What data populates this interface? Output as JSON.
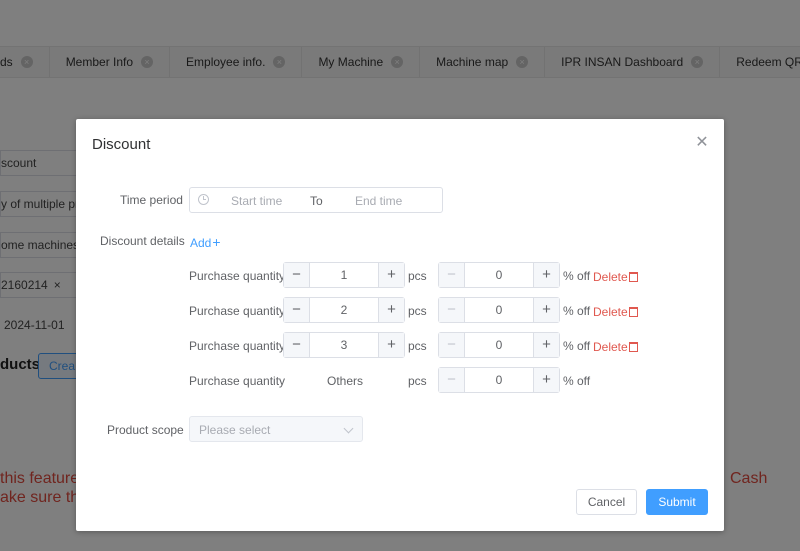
{
  "background": {
    "tabs": [
      {
        "label": "ds"
      },
      {
        "label": "Member Info"
      },
      {
        "label": "Employee info."
      },
      {
        "label": "My Machine"
      },
      {
        "label": "Machine map"
      },
      {
        "label": "IPR INSAN Dashboard"
      },
      {
        "label": "Redeem QR code"
      }
    ],
    "fields": {
      "discount": "scount",
      "multiple": "y of multiple pro",
      "machines": "ome machines",
      "tag": "2160214",
      "date": "2024-11-01"
    },
    "products_heading": "ducts",
    "create_button": "Crea",
    "warning_left_1": "this feature",
    "warning_left_2": "ake sure th",
    "warning_right": "Cash"
  },
  "dialog": {
    "title": "Discount",
    "time_period_label": "Time period",
    "start_placeholder": "Start time",
    "range_separator": "To",
    "end_placeholder": "End time",
    "discount_details_label": "Discount details",
    "add_label": "Add",
    "rows": [
      {
        "label": "Purchase quantity",
        "quantity": "1",
        "quantity_unit": "pcs",
        "discount": "0",
        "discount_unit": "% off",
        "delete_label": "Delete"
      },
      {
        "label": "Purchase quantity",
        "quantity": "2",
        "quantity_unit": "pcs",
        "discount": "0",
        "discount_unit": "% off",
        "delete_label": "Delete"
      },
      {
        "label": "Purchase quantity",
        "quantity": "3",
        "quantity_unit": "pcs",
        "discount": "0",
        "discount_unit": "% off",
        "delete_label": "Delete"
      }
    ],
    "others_row": {
      "label": "Purchase quantity",
      "quantity_text": "Others",
      "quantity_unit": "pcs",
      "discount": "0",
      "discount_unit": "% off"
    },
    "product_scope_label": "Product scope",
    "product_scope_placeholder": "Please select",
    "cancel_label": "Cancel",
    "submit_label": "Submit"
  },
  "icons": {
    "close": "close-icon",
    "clock": "clock-icon",
    "plus": "plus-icon",
    "minus": "minus-icon",
    "trash": "trash-icon",
    "chevron": "chevron-down-icon"
  },
  "colors": {
    "primary": "#409eff",
    "danger": "#e0584f",
    "overlay": "rgba(0,0,0,0.5)"
  }
}
